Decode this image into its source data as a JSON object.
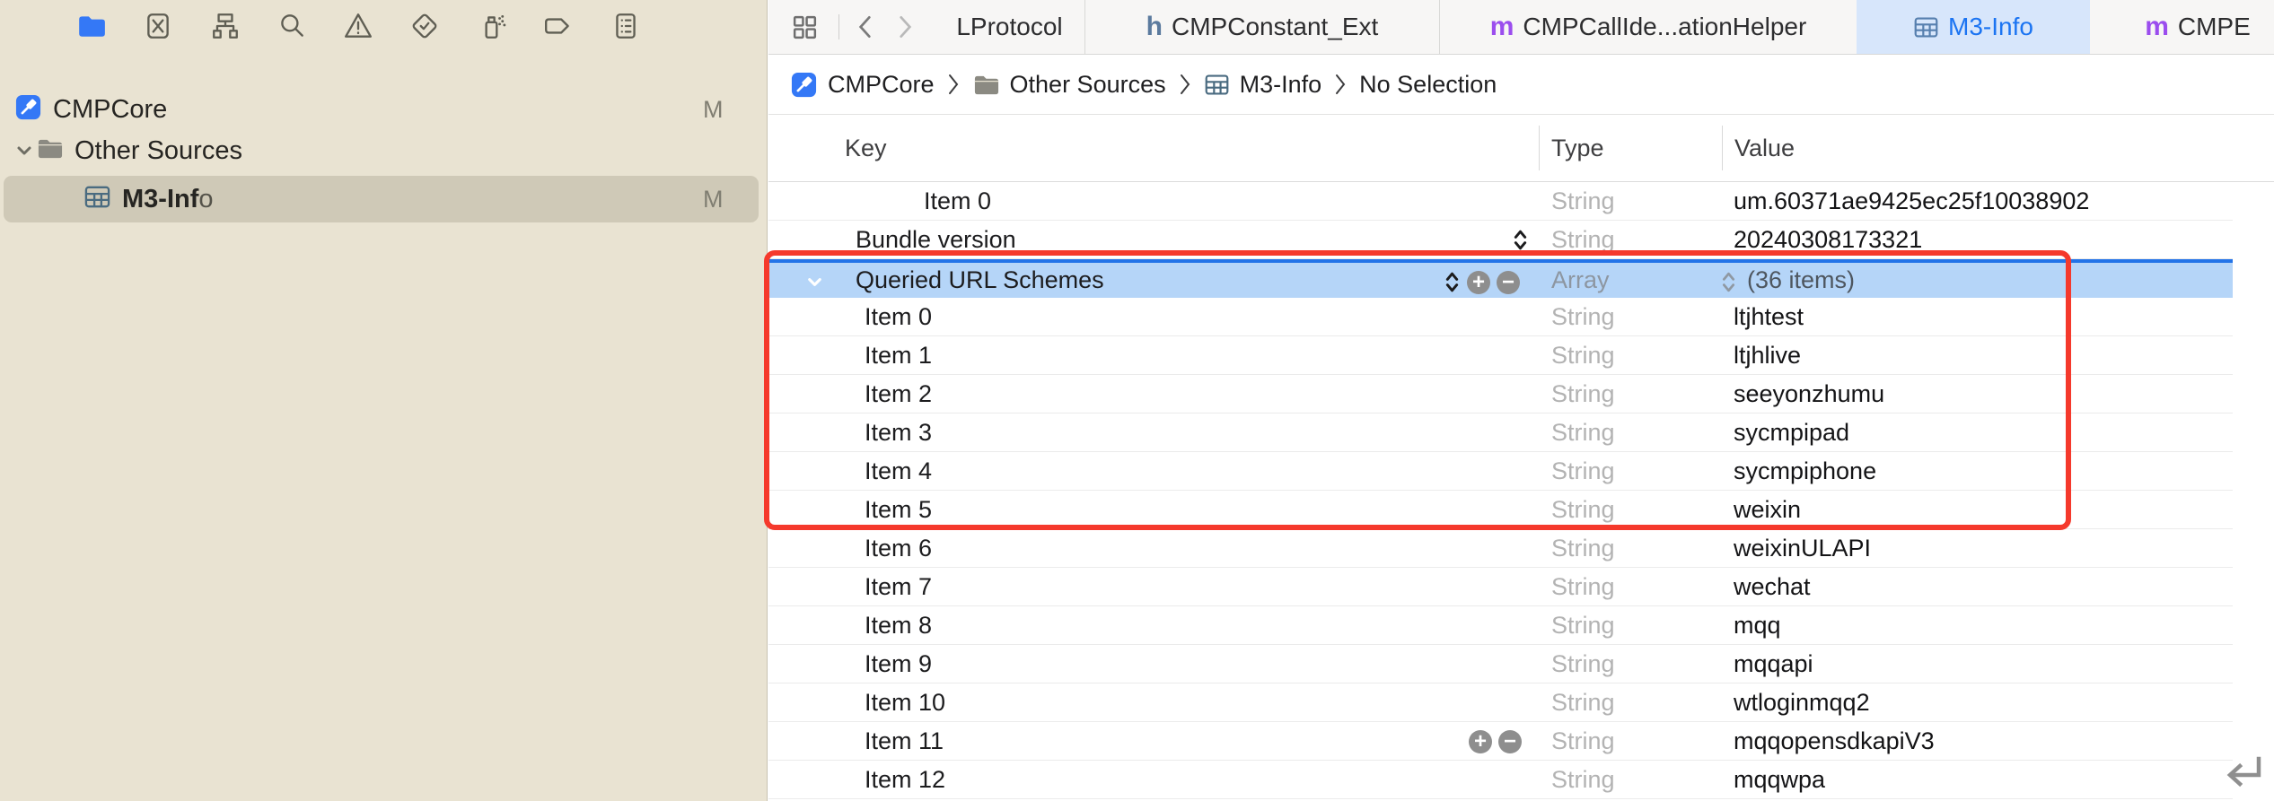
{
  "colors": {
    "accent_blue": "#3478F6",
    "selected_row_bg": "#B5D5F8",
    "selected_row_border": "#2273E8",
    "annotation_red": "#F5392C",
    "active_tab_bg": "#D7E6FB",
    "active_tab_text": "#1B74F2",
    "sidebar_bg": "#E9E3D2",
    "sidebar_selection": "#CFC9B7",
    "objc_m_purple": "#9B4DEE",
    "header_h_blue": "#5B7A9E",
    "type_gray": "#B3B3B3"
  },
  "sidebar": {
    "navigator_icons": [
      {
        "name": "project-navigator",
        "selected": true
      },
      {
        "name": "source-control-navigator",
        "selected": false
      },
      {
        "name": "symbol-navigator",
        "selected": false
      },
      {
        "name": "find-navigator",
        "selected": false
      },
      {
        "name": "issue-navigator",
        "selected": false
      },
      {
        "name": "test-navigator",
        "selected": false
      },
      {
        "name": "debug-navigator",
        "selected": false
      },
      {
        "name": "breakpoint-navigator",
        "selected": false
      },
      {
        "name": "report-navigator",
        "selected": false
      }
    ],
    "project": {
      "name": "CMPCore",
      "badge": "M"
    },
    "group": {
      "name": "Other Sources"
    },
    "file": {
      "name_bold": "M3-Inf",
      "name_tail": "o",
      "badge": "M"
    }
  },
  "tabbar": {
    "tabs": [
      {
        "label": "LProtocol",
        "icon": "none",
        "active": false
      },
      {
        "label": "CMPConstant_Ext",
        "icon": "h",
        "active": false
      },
      {
        "label": "CMPCallIde...ationHelper",
        "icon": "m",
        "active": false
      },
      {
        "label": "M3-Info",
        "icon": "plist",
        "active": true
      },
      {
        "label": "CMPE",
        "icon": "m",
        "active": false
      }
    ]
  },
  "breadcrumb": {
    "items": [
      {
        "label": "CMPCore",
        "icon": "app"
      },
      {
        "label": "Other Sources",
        "icon": "folder"
      },
      {
        "label": "M3-Info",
        "icon": "plist"
      },
      {
        "label": "No Selection",
        "icon": "none"
      }
    ]
  },
  "table": {
    "columns": [
      "Key",
      "Type",
      "Value"
    ],
    "rows": [
      {
        "key": "Item 0",
        "indent": 3,
        "type": "String",
        "value": "um.60371ae9425ec25f10038902"
      },
      {
        "key": "Bundle version",
        "indent": 1,
        "type": "String",
        "value": "20240308173321",
        "key_stepper": true
      },
      {
        "key": "Queried URL Schemes",
        "indent": 1,
        "type": "Array",
        "value": "(36 items)",
        "selected": true,
        "chevron": true,
        "key_stepper": true,
        "plus_minus": true,
        "value_stepper": true
      },
      {
        "key": "Item 0",
        "indent": 2,
        "type": "String",
        "value": "ltjhtest"
      },
      {
        "key": "Item 1",
        "indent": 2,
        "type": "String",
        "value": "ltjhlive"
      },
      {
        "key": "Item 2",
        "indent": 2,
        "type": "String",
        "value": "seeyonzhumu"
      },
      {
        "key": "Item 3",
        "indent": 2,
        "type": "String",
        "value": "sycmpipad"
      },
      {
        "key": "Item 4",
        "indent": 2,
        "type": "String",
        "value": "sycmpiphone"
      },
      {
        "key": "Item 5",
        "indent": 2,
        "type": "String",
        "value": "weixin"
      },
      {
        "key": "Item 6",
        "indent": 2,
        "type": "String",
        "value": "weixinULAPI"
      },
      {
        "key": "Item 7",
        "indent": 2,
        "type": "String",
        "value": "wechat"
      },
      {
        "key": "Item 8",
        "indent": 2,
        "type": "String",
        "value": "mqq"
      },
      {
        "key": "Item 9",
        "indent": 2,
        "type": "String",
        "value": "mqqapi"
      },
      {
        "key": "Item 10",
        "indent": 2,
        "type": "String",
        "value": "wtloginmqq2"
      },
      {
        "key": "Item 11",
        "indent": 2,
        "type": "String",
        "value": "mqqopensdkapiV3",
        "plus_minus": true
      },
      {
        "key": "Item 12",
        "indent": 2,
        "type": "String",
        "value": "mqqwpa"
      }
    ]
  },
  "annotation": {
    "type": "red-highlight-box",
    "around": "Queried URL Schemes array header and Item 0 through Item 5"
  }
}
